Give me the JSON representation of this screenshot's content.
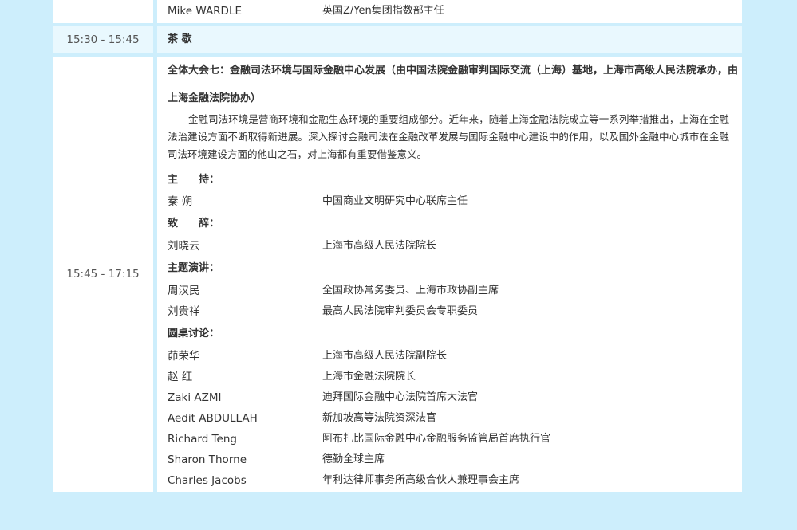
{
  "top_row": {
    "name": "Mike WARDLE",
    "role": "英国Z/Yen集团指数部主任"
  },
  "break_row": {
    "time": "15:30 - 15:45",
    "label": "茶 歇"
  },
  "session": {
    "time": "15:45 - 17:15",
    "title": "全体大会七：金融司法环境与国际金融中心发展（由中国法院金融审判国际交流（上海）基地，上海市高级人民法院承办，由上海金融法院协办）",
    "description": "金融司法环境是营商环境和金融生态环境的重要组成部分。近年来，随着上海金融法院成立等一系列举措推出，上海在金融法治建设方面不断取得新进展。深入探讨金融司法在金融改革发展与国际金融中心建设中的作用，以及国外金融中心城市在金融司法环境建设方面的他山之石，对上海都有重要借鉴意义。",
    "host_label": "主　　持：",
    "host": {
      "name": "秦 朔",
      "role": "中国商业文明研究中心联席主任"
    },
    "address_label": "致　　辞：",
    "address": {
      "name": "刘晓云",
      "role": "上海市高级人民法院院长"
    },
    "keynote_label": "主题演讲：",
    "keynotes": [
      {
        "name": "周汉民",
        "role": "全国政协常务委员、上海市政协副主席"
      },
      {
        "name": "刘贵祥",
        "role": "最高人民法院审判委员会专职委员"
      }
    ],
    "roundtable_label": "圆桌讨论：",
    "roundtable": [
      {
        "name": "茆荣华",
        "role": "上海市高级人民法院副院长"
      },
      {
        "name": "赵 红",
        "role": "上海市金融法院院长"
      },
      {
        "name": "Zaki AZMI",
        "role": "迪拜国际金融中心法院首席大法官"
      },
      {
        "name": "Aedit ABDULLAH",
        "role": "新加坡高等法院资深法官"
      },
      {
        "name": "Richard Teng",
        "role": "阿布扎比国际金融中心金融服务监管局首席执行官"
      },
      {
        "name": "Sharon Thorne",
        "role": "德勤全球主席"
      },
      {
        "name": "Charles Jacobs",
        "role": "年利达律师事务所高级合伙人兼理事会主席"
      }
    ]
  }
}
